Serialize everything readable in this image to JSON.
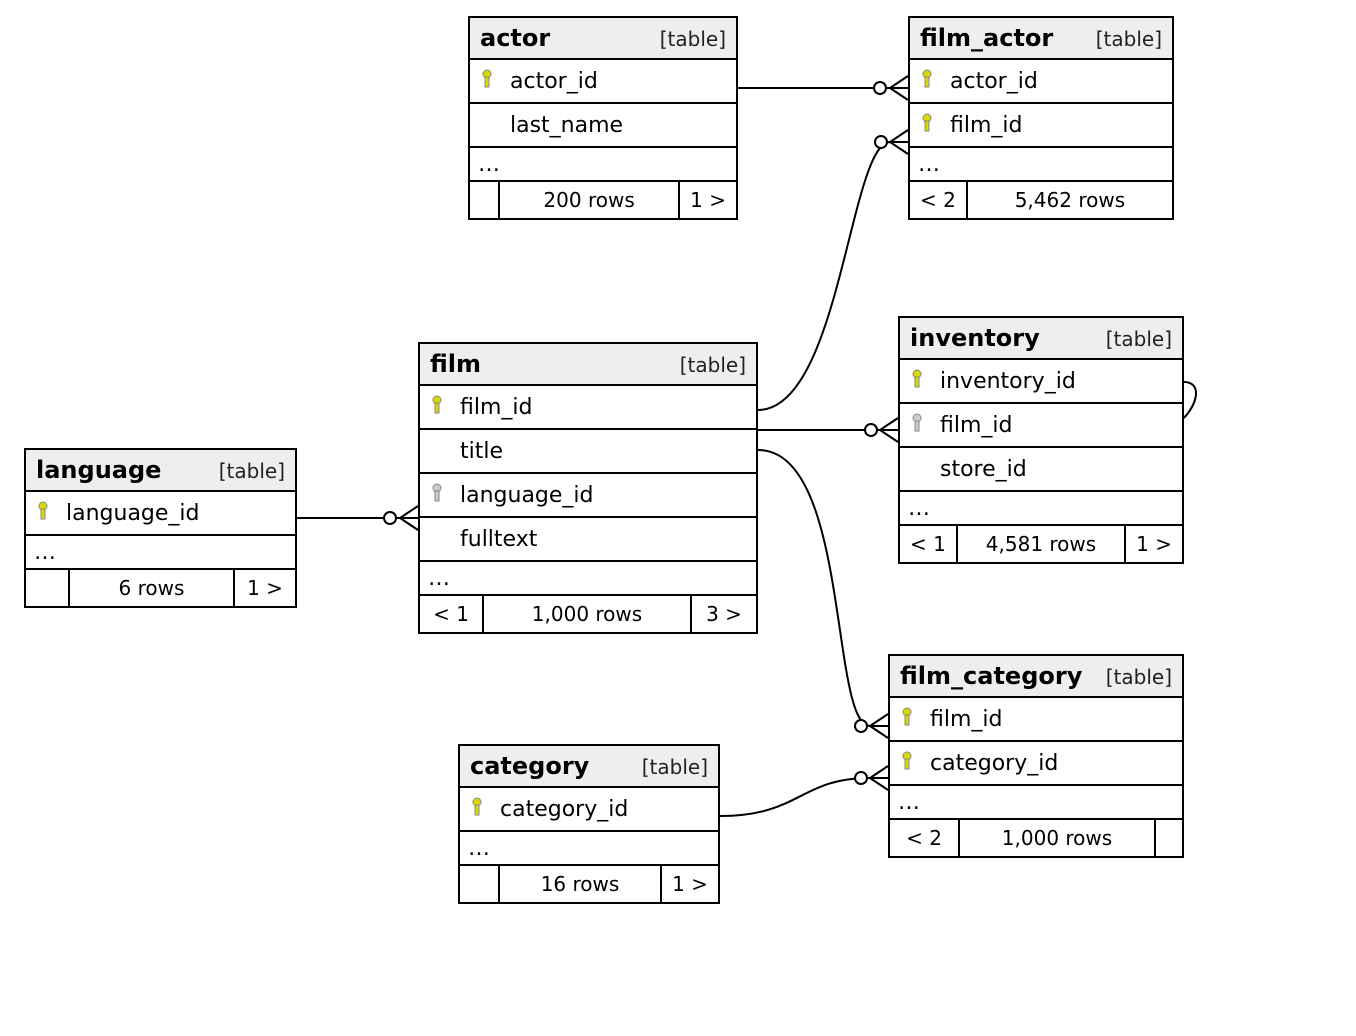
{
  "meta": {
    "type_label": "[table]",
    "ellipsis": "…"
  },
  "tables": {
    "actor": {
      "name": "actor",
      "columns": [
        {
          "name": "actor_id",
          "key": "pk"
        },
        {
          "name": "last_name",
          "key": null
        }
      ],
      "footer": {
        "in": "",
        "rows": "200 rows",
        "out": "1 >"
      }
    },
    "film_actor": {
      "name": "film_actor",
      "columns": [
        {
          "name": "actor_id",
          "key": "pk"
        },
        {
          "name": "film_id",
          "key": "pk"
        }
      ],
      "footer": {
        "in": "< 2",
        "rows": "5,462 rows",
        "out": ""
      }
    },
    "language": {
      "name": "language",
      "columns": [
        {
          "name": "language_id",
          "key": "pk"
        }
      ],
      "footer": {
        "in": "",
        "rows": "6 rows",
        "out": "1 >"
      }
    },
    "film": {
      "name": "film",
      "columns": [
        {
          "name": "film_id",
          "key": "pk"
        },
        {
          "name": "title",
          "key": null
        },
        {
          "name": "language_id",
          "key": "fk"
        },
        {
          "name": "fulltext",
          "key": null
        }
      ],
      "footer": {
        "in": "< 1",
        "rows": "1,000 rows",
        "out": "3 >"
      }
    },
    "inventory": {
      "name": "inventory",
      "columns": [
        {
          "name": "inventory_id",
          "key": "pk"
        },
        {
          "name": "film_id",
          "key": "fk"
        },
        {
          "name": "store_id",
          "key": null
        }
      ],
      "footer": {
        "in": "< 1",
        "rows": "4,581 rows",
        "out": "1 >"
      }
    },
    "category": {
      "name": "category",
      "columns": [
        {
          "name": "category_id",
          "key": "pk"
        }
      ],
      "footer": {
        "in": "",
        "rows": "16 rows",
        "out": "1 >"
      }
    },
    "film_category": {
      "name": "film_category",
      "columns": [
        {
          "name": "film_id",
          "key": "pk"
        },
        {
          "name": "category_id",
          "key": "pk"
        }
      ],
      "footer": {
        "in": "< 2",
        "rows": "1,000 rows",
        "out": ""
      }
    }
  },
  "relationships": [
    {
      "from": "language.language_id",
      "to": "film.language_id"
    },
    {
      "from": "actor.actor_id",
      "to": "film_actor.actor_id"
    },
    {
      "from": "film.film_id",
      "to": "film_actor.film_id"
    },
    {
      "from": "film.film_id",
      "to": "inventory.film_id"
    },
    {
      "from": "film.film_id",
      "to": "film_category.film_id"
    },
    {
      "from": "category.category_id",
      "to": "film_category.category_id"
    }
  ]
}
